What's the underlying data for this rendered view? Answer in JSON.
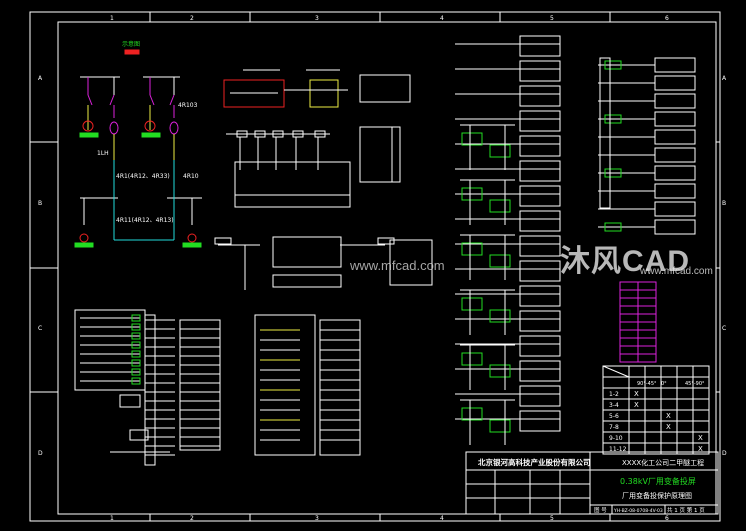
{
  "grid": {
    "columns": [
      "1",
      "2",
      "3",
      "4",
      "5",
      "6"
    ],
    "rows": [
      "A",
      "B",
      "C",
      "D"
    ]
  },
  "single_line": {
    "title": "示意图",
    "labels": [
      "4R1(4R12、4R33)",
      "4R10",
      "1LH",
      "4R11(4R12、4R13)",
      "4R103"
    ]
  },
  "title_block": {
    "company": "北京银河高科技产业股份有限公司",
    "project": "XXXX化工公司二甲醚工程",
    "drawing_title": "0.38kV厂用变备投屏",
    "subtitle": "厂用变备投保护原理图",
    "drawing_no_label": "图 号",
    "drawing_no": "YH-BZ-08-0708-4V-03",
    "sheet": "共 1 页 第 1 页"
  },
  "switch_table": {
    "columns": [
      "90°-45°",
      "0°",
      "45°-90°"
    ],
    "rows": [
      {
        "label": "1-2",
        "marks": [
          1
        ]
      },
      {
        "label": "3-4",
        "marks": [
          1
        ]
      },
      {
        "label": "5-6",
        "marks": [
          3
        ]
      },
      {
        "label": "7-8",
        "marks": [
          3
        ]
      },
      {
        "label": "9-10",
        "marks": [
          5
        ]
      },
      {
        "label": "11-12",
        "marks": [
          5
        ]
      }
    ],
    "mark": "X"
  },
  "watermark": {
    "url": "www.mfcad.com",
    "logo": "沐风CAD",
    "logo_url": "www.mfcad.com"
  },
  "colors": {
    "background": "#000000",
    "line": "#ffffff",
    "green": "#22dd22",
    "red": "#ee2222",
    "magenta": "#dd22dd",
    "cyan": "#22dddd",
    "yellow": "#eeee44"
  }
}
